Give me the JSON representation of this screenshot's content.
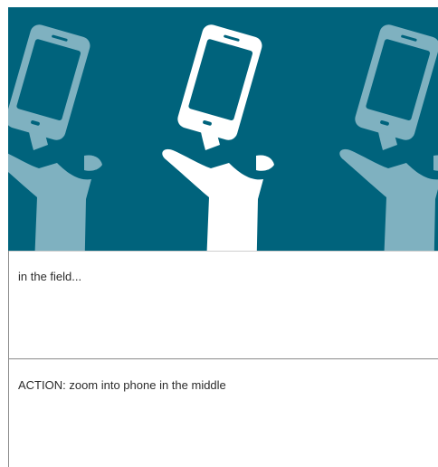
{
  "storyboard": {
    "illustration": {
      "subject": "raised-hands-holding-phones",
      "colors": {
        "background": "#00637c",
        "muted_hand": "#7fb1c0",
        "highlight_hand": "#ffffff"
      }
    },
    "caption": "in the field...",
    "action_note": "ACTION: zoom into phone in the middle"
  }
}
